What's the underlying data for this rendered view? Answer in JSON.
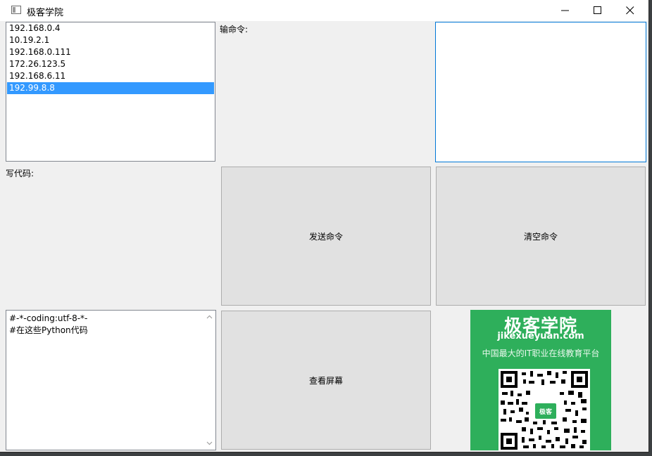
{
  "window": {
    "title": "极客学院",
    "icon": "app-window-icon",
    "controls": [
      "minimize-icon",
      "maximize-icon",
      "close-icon"
    ]
  },
  "ip_list": {
    "items": [
      "192.168.0.4",
      "10.19.2.1",
      "192.168.0.111",
      "172.26.123.5",
      "192.168.6.11",
      "192.99.8.8"
    ],
    "selected": "192.99.8.8"
  },
  "command": {
    "label": "输命令:",
    "value": ""
  },
  "code": {
    "label": "写代码:",
    "lines": [
      "#-*-coding:utf-8-*-",
      "#在这些Python代码"
    ]
  },
  "buttons": {
    "send": "发送命令",
    "clear": "清空命令",
    "screen": "查看屏幕"
  },
  "promo": {
    "title": "极客学院",
    "domain": "jikexueyuan.com",
    "slogan": "中国最大的IT职业在线教育平台",
    "badge": "极客",
    "color": "#2eaf5b"
  }
}
